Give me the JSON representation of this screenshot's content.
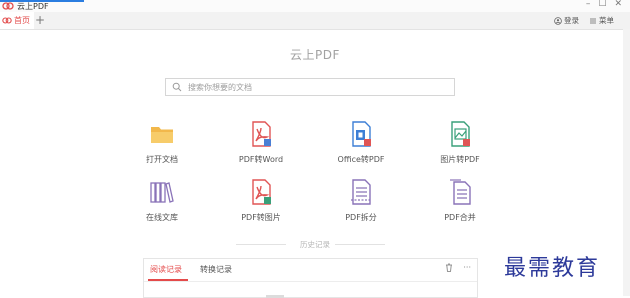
{
  "window": {
    "title": "云上PDF",
    "controls": {
      "minimize": "–",
      "maximize": "☐",
      "close": "✕"
    }
  },
  "tabs": {
    "home_label": "首页",
    "new_tab": "+"
  },
  "header": {
    "login_label": "登录",
    "menu_label": "菜单"
  },
  "main": {
    "app_title": "云上PDF",
    "search_placeholder": "搜索你想要的文档",
    "tools": [
      {
        "label": "打开文档",
        "icon": "folder-icon"
      },
      {
        "label": "PDF转Word",
        "icon": "pdf-to-word-icon"
      },
      {
        "label": "Office转PDF",
        "icon": "office-to-pdf-icon"
      },
      {
        "label": "图片转PDF",
        "icon": "image-to-pdf-icon"
      },
      {
        "label": "在线文库",
        "icon": "library-icon"
      },
      {
        "label": "PDF转图片",
        "icon": "pdf-to-image-icon"
      },
      {
        "label": "PDF拆分",
        "icon": "pdf-split-icon"
      },
      {
        "label": "PDF合并",
        "icon": "pdf-merge-icon"
      }
    ],
    "history_title": "历史记录",
    "history_tabs": [
      "阅读记录",
      "转换记录"
    ],
    "history_more": "···"
  },
  "watermark": "最需教育",
  "colors": {
    "accent": "#e44a4a",
    "window_accent": "#2b7de0",
    "watermark": "#2d3a9a"
  }
}
